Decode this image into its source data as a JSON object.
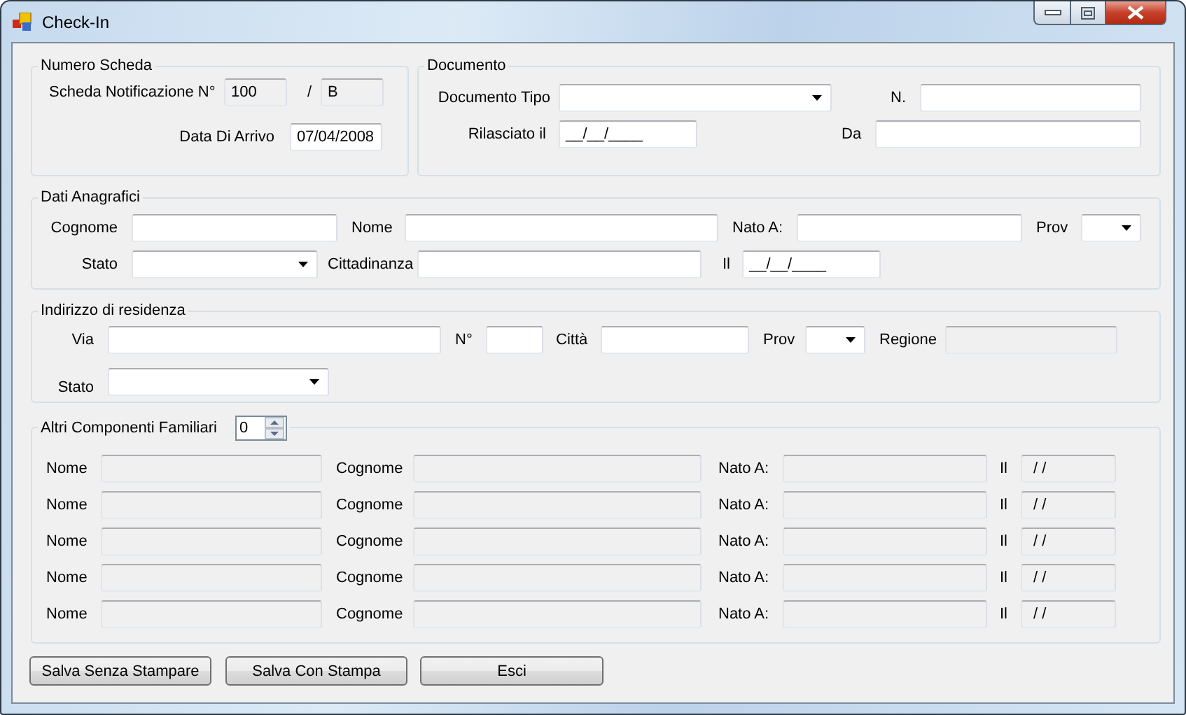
{
  "window": {
    "title": "Check-In"
  },
  "numero_scheda": {
    "title": "Numero Scheda",
    "label": "Scheda Notificazione N°",
    "number": {
      "value": "100",
      "disabled": true
    },
    "separator": "/",
    "series": {
      "value": "B",
      "disabled": true
    },
    "arrival_label": "Data Di Arrivo",
    "arrival": {
      "value": "07/04/2008",
      "disabled": false
    }
  },
  "documento": {
    "title": "Documento",
    "tipo_label": "Documento Tipo",
    "numero_label": "N.",
    "rilasciato_label": "Rilasciato il",
    "rilasciato_value": "__/__/____",
    "da_label": "Da"
  },
  "dati_anagrafici": {
    "title": "Dati Anagrafici",
    "cognome_label": "Cognome",
    "nome_label": "Nome",
    "nato_label": "Nato A:",
    "prov_label": "Prov",
    "stato_label": "Stato",
    "cittadinanza_label": "Cittadinanza",
    "il_label": "Il",
    "il_value": "__/__/____"
  },
  "indirizzo": {
    "title": "Indirizzo di residenza",
    "via_label": "Via",
    "numero_label": "N°",
    "citta_label": "Città",
    "prov_label": "Prov",
    "regione_label": "Regione",
    "regione_disabled": true,
    "stato_label": "Stato"
  },
  "altri_componenti": {
    "title": "Altri Componenti Familiari",
    "count": "0",
    "members": [
      {
        "nome_label": "Nome",
        "cognome_label": "Cognome",
        "nato_label": "Nato A:",
        "il_label": "Il",
        "il_value": "/ /",
        "disabled": true
      },
      {
        "nome_label": "Nome",
        "cognome_label": "Cognome",
        "nato_label": "Nato A:",
        "il_label": "Il",
        "il_value": "/ /",
        "disabled": true
      },
      {
        "nome_label": "Nome",
        "cognome_label": "Cognome",
        "nato_label": "Nato A:",
        "il_label": "Il",
        "il_value": "/ /",
        "disabled": true
      },
      {
        "nome_label": "Nome",
        "cognome_label": "Cognome",
        "nato_label": "Nato A:",
        "il_label": "Il",
        "il_value": "/ /",
        "disabled": true
      },
      {
        "nome_label": "Nome",
        "cognome_label": "Cognome",
        "nato_label": "Nato A:",
        "il_label": "Il",
        "il_value": "/ /",
        "disabled": true
      }
    ]
  },
  "buttons": [
    "Salva Senza Stampare",
    "Salva Con Stampa",
    "Esci"
  ]
}
